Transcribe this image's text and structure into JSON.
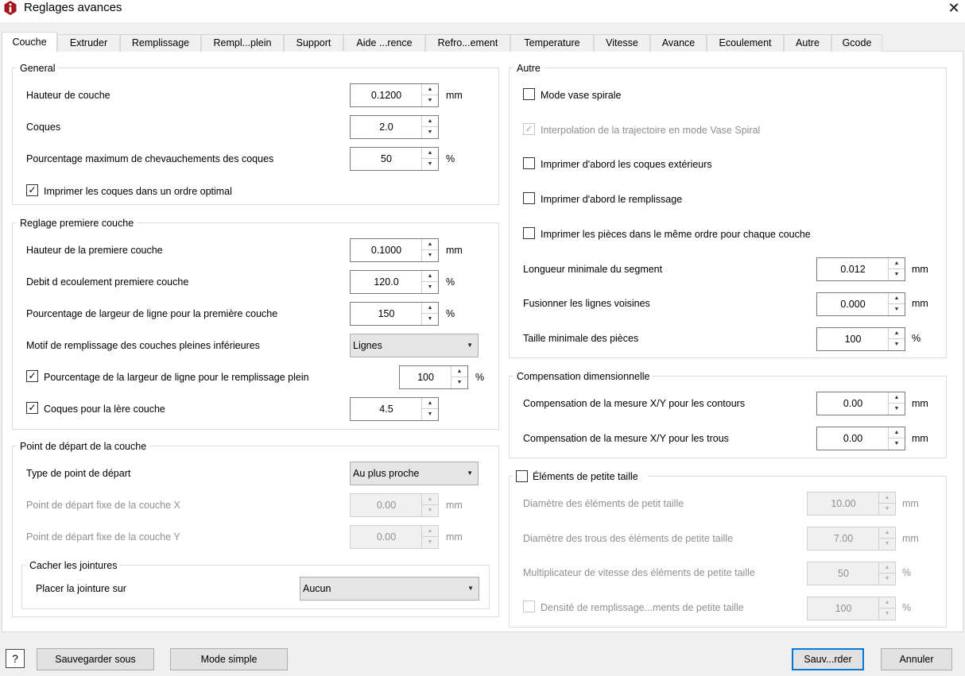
{
  "window": {
    "title": "Reglages avances",
    "icon": "info-icon",
    "accent": "#0078d7",
    "icon_color": "#a4161a"
  },
  "tabs": [
    {
      "label": "Couche",
      "active": true
    },
    {
      "label": "Extruder"
    },
    {
      "label": "Remplissage"
    },
    {
      "label": "Rempl...plein"
    },
    {
      "label": "Support"
    },
    {
      "label": "Aide ...rence"
    },
    {
      "label": "Refro...ement"
    },
    {
      "label": "Temperature"
    },
    {
      "label": "Vitesse"
    },
    {
      "label": "Avance"
    },
    {
      "label": "Ecoulement"
    },
    {
      "label": "Autre"
    },
    {
      "label": "Gcode"
    }
  ],
  "general": {
    "title": "General",
    "layer_height": {
      "label": "Hauteur de couche",
      "value": "0.1200",
      "unit": "mm"
    },
    "shells": {
      "label": "Coques",
      "value": "2.0"
    },
    "overlap": {
      "label": "Pourcentage maximum de chevauchements des coques",
      "value": "50",
      "unit": "%"
    },
    "optimal_order": {
      "label": "Imprimer les coques dans un ordre optimal",
      "checked": true
    }
  },
  "first_layer": {
    "title": "Reglage premiere couche",
    "height": {
      "label": "Hauteur de la premiere couche",
      "value": "0.1000",
      "unit": "mm"
    },
    "flow": {
      "label": "Debit d ecoulement premiere couche",
      "value": "120.0",
      "unit": "%"
    },
    "line_width": {
      "label": "Pourcentage de largeur de ligne pour la première couche",
      "value": "150",
      "unit": "%"
    },
    "bottom_pattern": {
      "label": "Motif de remplissage des couches pleines inférieures",
      "value": "Lignes"
    },
    "solid_width": {
      "label": "Pourcentage de la largeur de ligne pour le remplissage plein",
      "value": "100",
      "unit": "%",
      "checked": true
    },
    "first_shells": {
      "label": "Coques pour la lère couche",
      "value": "4.5",
      "checked": true
    }
  },
  "start_point": {
    "title": "Point de départ de la couche",
    "type": {
      "label": "Type de point de départ",
      "value": "Au plus proche"
    },
    "fixed_x": {
      "label": "Point de départ fixe de la couche X",
      "value": "0.00",
      "unit": "mm"
    },
    "fixed_y": {
      "label": "Point de départ fixe de la couche Y",
      "value": "0.00",
      "unit": "mm"
    },
    "seam": {
      "title": "Cacher les jointures",
      "label": "Placer la jointure sur",
      "value": "Aucun"
    }
  },
  "other": {
    "title": "Autre",
    "spiral": {
      "label": "Mode vase spirale",
      "checked": false
    },
    "spiral_interp": {
      "label": "Interpolation de la trajectoire en mode Vase Spiral",
      "checked": true
    },
    "outer_first": {
      "label": "Imprimer d'abord les coques extérieurs",
      "checked": false
    },
    "infill_first": {
      "label": "Imprimer d'abord le remplissage",
      "checked": false
    },
    "same_order": {
      "label": "Imprimer les pièces dans le même ordre pour chaque couche",
      "checked": false
    },
    "min_segment": {
      "label": "Longueur minimale du segment",
      "value": "0.012",
      "unit": "mm"
    },
    "merge_lines": {
      "label": "Fusionner les lignes voisines",
      "value": "0.000",
      "unit": "mm"
    },
    "min_part": {
      "label": "Taille minimale des pièces",
      "value": "100",
      "unit": "%"
    }
  },
  "compensation": {
    "title": "Compensation dimensionnelle",
    "contours": {
      "label": "Compensation de la mesure X/Y pour les contours",
      "value": "0.00",
      "unit": "mm"
    },
    "holes": {
      "label": "Compensation de la mesure X/Y pour les trous",
      "value": "0.00",
      "unit": "mm"
    }
  },
  "small": {
    "title": "Éléments de petite taille",
    "checked": false,
    "diameter": {
      "label": "Diamètre des éléments de petit taille",
      "value": "10.00",
      "unit": "mm"
    },
    "hole_diameter": {
      "label": "Diamètre des trous des éléments de petite taille",
      "value": "7.00",
      "unit": "mm"
    },
    "speed": {
      "label": "Multiplicateur de vitesse des éléments de petite taille",
      "value": "50",
      "unit": "%"
    },
    "density": {
      "label": "Densité de remplissage...ments de petite taille",
      "value": "100",
      "unit": "%"
    }
  },
  "footer": {
    "help": "?",
    "save_as": "Sauvegarder sous",
    "simple_mode": "Mode simple",
    "save": "Sauv...rder",
    "cancel": "Annuler"
  },
  "glyphs": {
    "close": "✕",
    "check": "✓",
    "up": "▲",
    "down": "▼",
    "dropdown": "▼"
  }
}
